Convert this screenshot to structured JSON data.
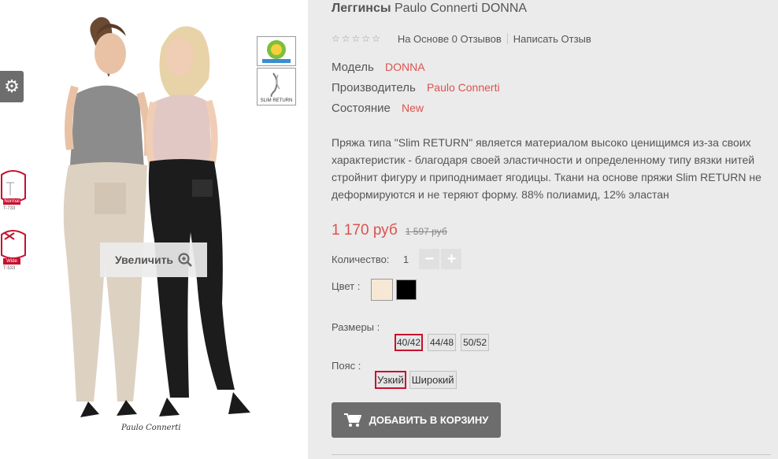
{
  "image_panel": {
    "zoom_label": "Увеличить",
    "brand_caption": "Paulo Connerti",
    "badge_slim_label": "SLIM RETURN",
    "thumb_normal": {
      "cap": "Normal",
      "code": "T-733"
    },
    "thumb_wide": {
      "cap": "Wide",
      "code": "T-533"
    },
    "icons": {
      "settings": "gear-icon",
      "zoom": "zoom-in-icon"
    }
  },
  "product": {
    "title_category": "Леггинсы",
    "title_name": "Paulo Connerti DONNA",
    "rating": {
      "stars": 0,
      "max": 5,
      "review_text": "На Основе 0 Отзывов",
      "write_review": "Написать Отзыв"
    },
    "specs": {
      "model_label": "Модель",
      "model_value": "DONNA",
      "maker_label": "Производитель",
      "maker_value": "Paulo Connerti",
      "condition_label": "Состояние",
      "condition_value": "New"
    },
    "description": "Пряжа типа \"Slim RETURN\" является материалом высоко ценищимся из-за своих характеристик - благодаря своей эластичности и определенному типу вязки нитей стройнит фигуру и приподнимает ягодицы. Ткани на основе пряжи Slim RETURN не деформируются и не теряют форму. 88% полиамид, 12% эластан",
    "price": "1 170 руб",
    "old_price": "1 597 руб",
    "quantity_label": "Количество:",
    "quantity_value": "1",
    "color_label": "Цвет :",
    "colors": [
      "#f6e8d4",
      "#000000"
    ],
    "sizes_label": "Размеры :",
    "sizes": [
      {
        "label": "40/42",
        "selected": true
      },
      {
        "label": "44/48",
        "selected": false
      },
      {
        "label": "50/52",
        "selected": false
      }
    ],
    "belt_label": "Пояс :",
    "belts": [
      {
        "label": "Узкий",
        "selected": true
      },
      {
        "label": "Широкий",
        "selected": false
      }
    ],
    "add_to_cart": "ДОБАВИТЬ В КОРЗИНУ"
  },
  "colors_theme": {
    "accent": "#d9534f",
    "selected_border": "#c8102e",
    "button_bg": "#6d6d6d",
    "page_bg": "#ebebeb"
  }
}
